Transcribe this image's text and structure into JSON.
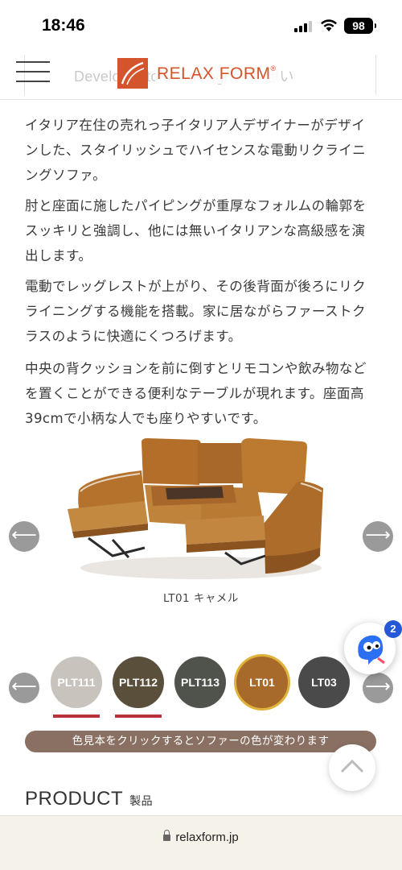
{
  "status_bar": {
    "time": "18:46",
    "battery": "98"
  },
  "header": {
    "ghost_text": "Developer to the designer の想い",
    "logo_text": "RELAX FORM",
    "logo_reg": "®",
    "brand_color": "#d4552b"
  },
  "description": [
    "イタリア在住の売れっ子イタリア人デザイナーがデザインした、スタイリッシュでハイセンスな電動リクライニングソファ。",
    "肘と座面に施したパイピングが重厚なフォルムの輪郭をスッキリと強調し、他には無いイタリアンな高級感を演出します。",
    "電動でレッグレストが上がり、その後背面が後ろにリクライニングする機能を搭載。家に居ながらファーストクラスのように快適にくつろげます。",
    "中央の背クッションを前に倒すとリモコンや飲み物などを置くことができる便利なテーブルが現れます。座面高39cmで小柄な人でも座りやすいです。"
  ],
  "product_image": {
    "caption": "LT01 キャメル",
    "leather_color": "#b9772c"
  },
  "swatches": [
    {
      "code": "PLT111",
      "color": "#c8c4bd",
      "text_color": "#ffffff",
      "underlined": true,
      "selected": false
    },
    {
      "code": "PLT112",
      "color": "#5a4f3b",
      "text_color": "#ffffff",
      "underlined": true,
      "selected": false
    },
    {
      "code": "PLT113",
      "color": "#4f534c",
      "text_color": "#ffffff",
      "underlined": false,
      "selected": false
    },
    {
      "code": "LT01",
      "color": "#a86a2a",
      "text_color": "#ffffff",
      "underlined": false,
      "selected": true
    },
    {
      "code": "LT03",
      "color": "#4a4a4a",
      "text_color": "#ffffff",
      "underlined": false,
      "selected": false
    }
  ],
  "swatch_hint": "色見本をクリックするとソファーの色が変わります",
  "chat": {
    "badge_count": "2"
  },
  "section": {
    "title": "PRODUCT",
    "subtitle": "製品"
  },
  "url_bar": {
    "domain": "relaxform.jp"
  }
}
